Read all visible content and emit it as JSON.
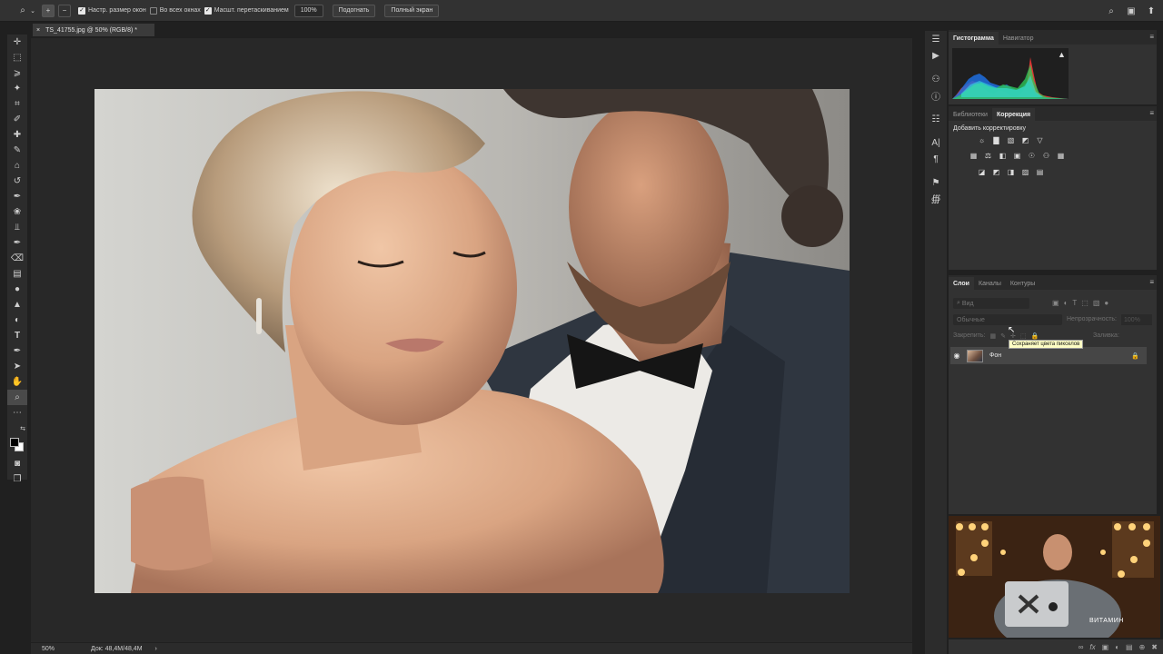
{
  "options_bar": {
    "resize_windows_label": "Настр. размер окон",
    "all_windows_label": "Во всех окнах",
    "scrubby_zoom_label": "Масшт. перетаскиванием",
    "zoom_value": "100%",
    "fit_screen_label": "Подогнать",
    "fill_screen_label": "Полный экран"
  },
  "document": {
    "tab_title": "TS_41755.jpg @ 50% (RGB/8) *",
    "close_icon": "×"
  },
  "status_bar": {
    "zoom": "50%",
    "doc_size": "Док: 48,4M/48,4M",
    "arrow": "›"
  },
  "histogram_panel": {
    "tabs": [
      "Гистограмма",
      "Навигатор"
    ]
  },
  "adjustments_panel": {
    "tabs": [
      "Библиотеки",
      "Коррекция"
    ],
    "title": "Добавить корректировку"
  },
  "layers_panel": {
    "tabs": [
      "Слои",
      "Каналы",
      "Контуры"
    ],
    "search_placeholder": "Вид",
    "blend_mode": "Обычные",
    "opacity_label": "Непрозрачность:",
    "opacity_value": "100%",
    "lock_label": "Закрепить:",
    "fill_label": "Заливка:",
    "tooltip": "Сохраняет цвета пикселов",
    "layers": [
      {
        "name": "Фон"
      }
    ]
  },
  "webcam": {
    "watermark": "ВИТАМИН"
  },
  "colors": {
    "app_bg": "#202020",
    "panel_bg": "#323232",
    "canvas_bg": "#282828",
    "tooltip_bg": "#fdfdc4"
  }
}
